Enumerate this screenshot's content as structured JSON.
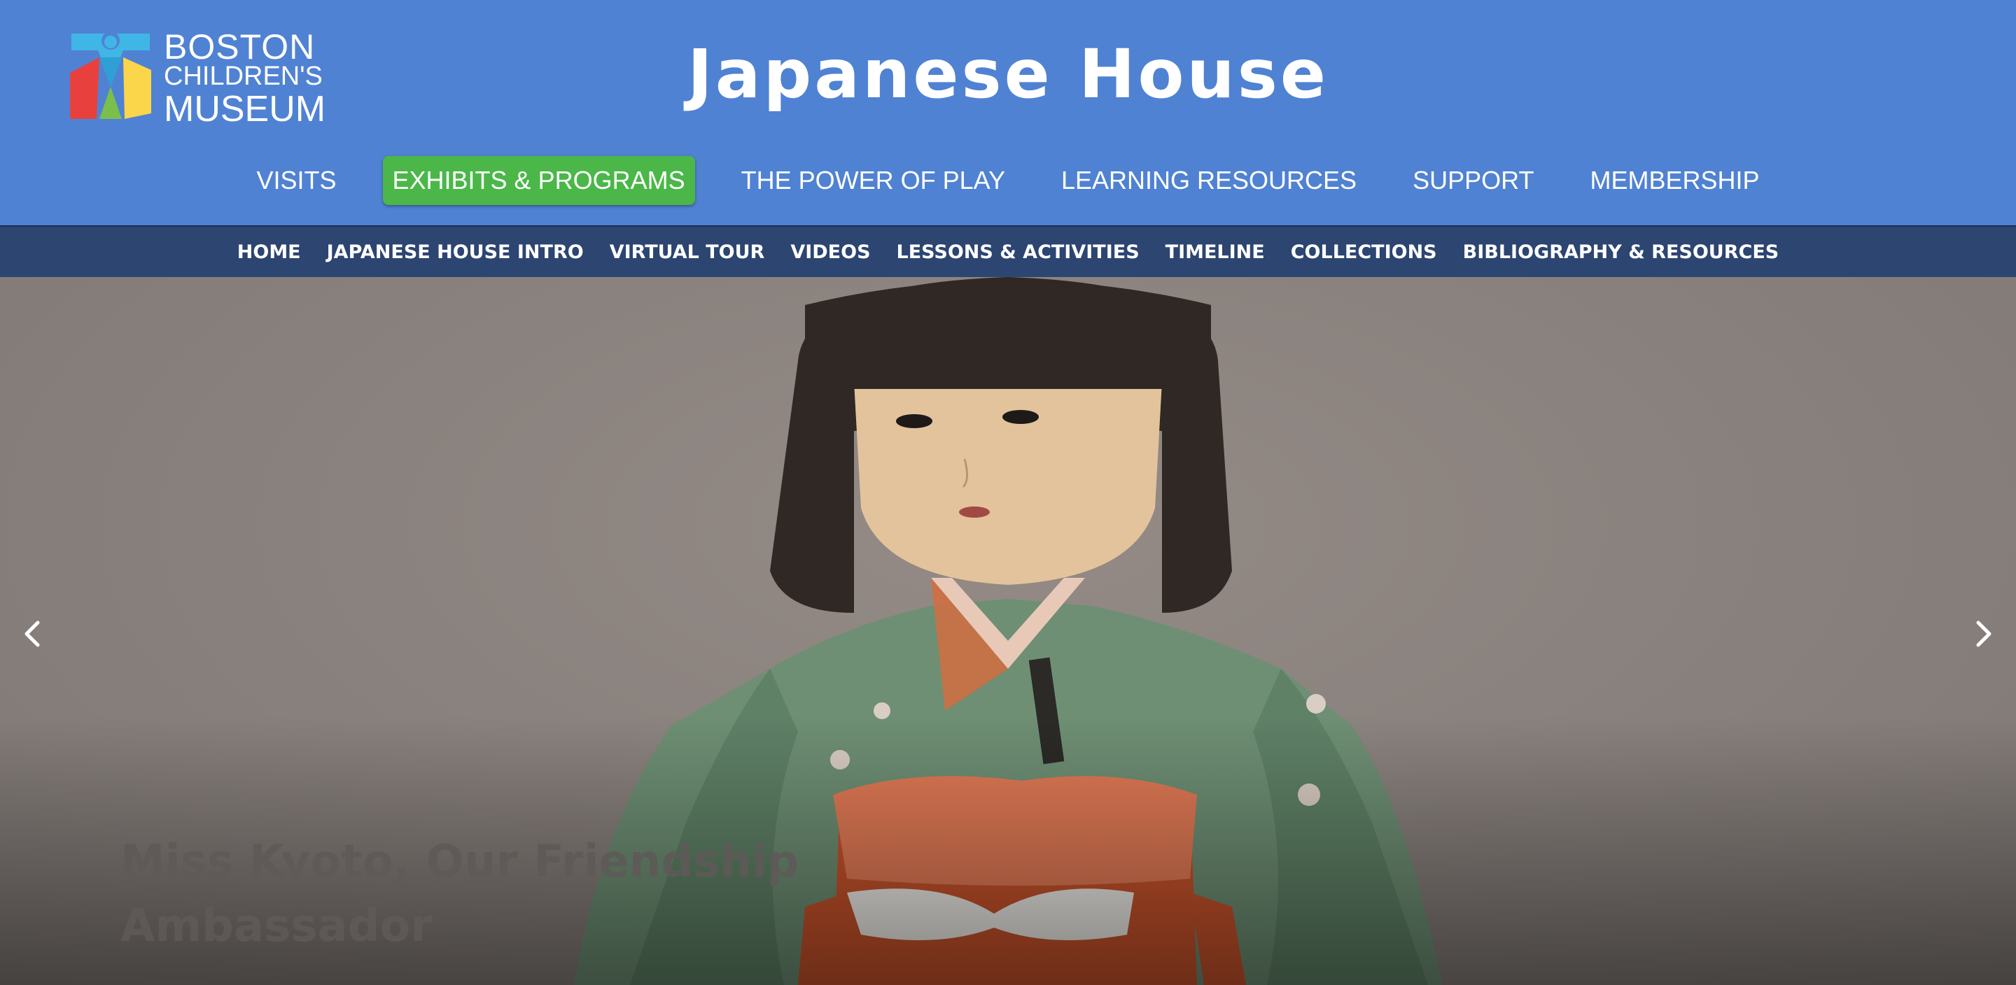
{
  "logo": {
    "line1": "BOSTON",
    "line2": "CHILDREN'S",
    "line3": "MUSEUM",
    "colors": [
      "#40b6e6",
      "#e8413d",
      "#fbd54a",
      "#7bbf4b"
    ]
  },
  "header": {
    "title": "Japanese House",
    "background": "#5082d3"
  },
  "main_nav": {
    "items": [
      {
        "label": "VISITS",
        "active": false
      },
      {
        "label": "EXHIBITS & PROGRAMS",
        "active": true
      },
      {
        "label": "THE POWER OF PLAY",
        "active": false
      },
      {
        "label": "LEARNING RESOURCES",
        "active": false
      },
      {
        "label": "SUPPORT",
        "active": false
      },
      {
        "label": "MEMBERSHIP",
        "active": false
      }
    ],
    "active_color": "#4bb749"
  },
  "sub_nav": {
    "background": "#2c4571",
    "items": [
      {
        "label": "HOME"
      },
      {
        "label": "JAPANESE HOUSE INTRO"
      },
      {
        "label": "VIRTUAL TOUR"
      },
      {
        "label": "VIDEOS"
      },
      {
        "label": "LESSONS & ACTIVITIES"
      },
      {
        "label": "TIMELINE"
      },
      {
        "label": "COLLECTIONS"
      },
      {
        "label": "BIBLIOGRAPHY & RESOURCES"
      }
    ]
  },
  "hero": {
    "caption": "Miss Kyoto, Our Friendship Ambassador",
    "prev_icon": "chevron-left-icon",
    "next_icon": "chevron-right-icon"
  }
}
